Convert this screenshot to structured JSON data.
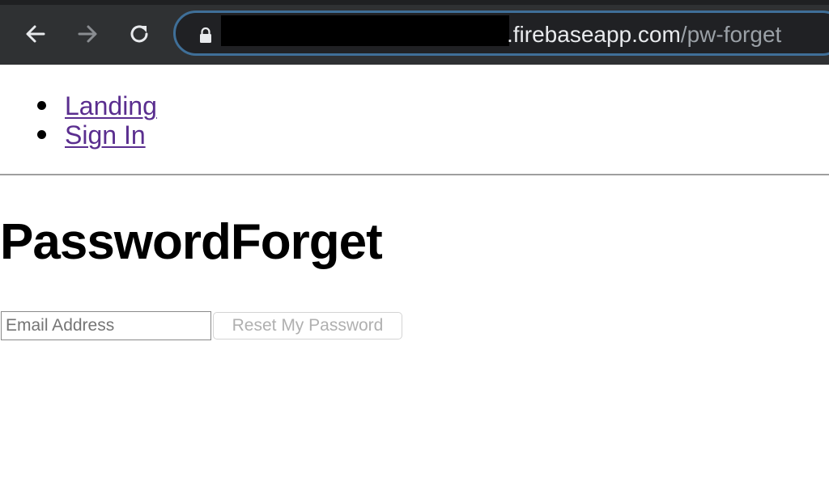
{
  "browser": {
    "url_domain": ".firebaseapp.com",
    "url_path": "/pw-forget",
    "icons": {
      "back": "back-arrow-icon",
      "forward": "forward-arrow-icon",
      "reload": "reload-icon",
      "lock": "lock-icon"
    },
    "colors": {
      "toolbar": "#2f3133",
      "omnibox_border": "#3f6f98"
    }
  },
  "navigation": {
    "items": [
      {
        "label": "Landing"
      },
      {
        "label": "Sign In"
      }
    ],
    "link_color": "#5a2e8f"
  },
  "main": {
    "title": "PasswordForget",
    "form": {
      "email_placeholder": "Email Address",
      "email_value": "",
      "submit_label": "Reset My Password",
      "submit_disabled": true
    }
  }
}
